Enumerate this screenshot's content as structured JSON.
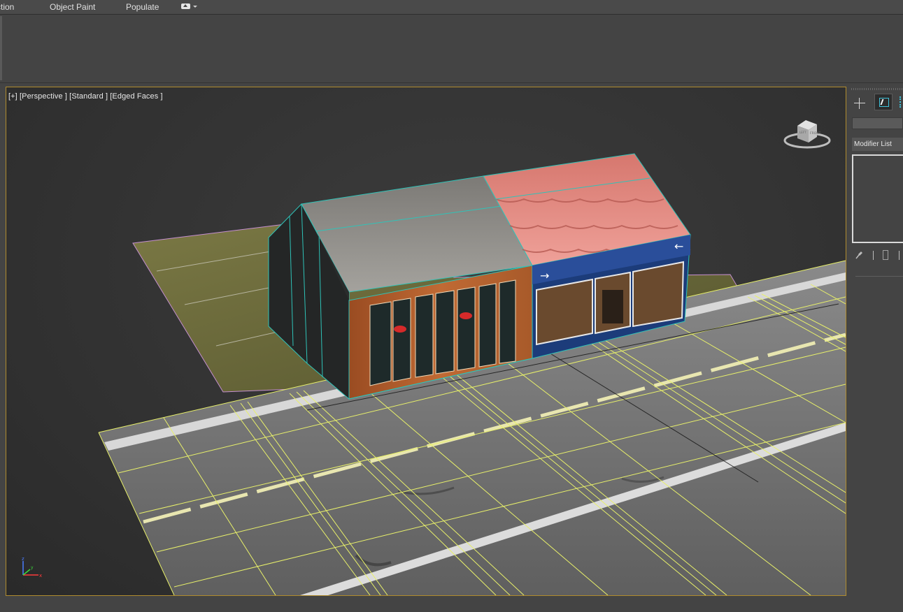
{
  "menubar": {
    "tabs": [
      "ction",
      "Object Paint",
      "Populate"
    ],
    "extra_tab_icon": "collapse-ribbon-icon"
  },
  "viewport": {
    "label": "[+] [Perspective ] [Standard ] [Edged Faces ]",
    "viewcube_face_front": "FRONT",
    "viewcube_face_left": "LEFT",
    "axis_x": "x",
    "axis_y": "y",
    "axis_z": "z",
    "scene": {
      "objects": [
        "grass-ground",
        "road-plane",
        "shop-brown-gray-roof",
        "shop-blue-red-roof"
      ],
      "colors": {
        "border_active": "#b08c2e",
        "grid_lines": "#e8f06a",
        "edge_highlight": "#2fc3b8",
        "red_roof": "#e0857d",
        "gray_roof": "#8c8a86",
        "shop_wood": "#b4602e",
        "shop_blue": "#1c3c7a",
        "grass": "#6e6c3c",
        "road": "#7a7a7a"
      }
    }
  },
  "command_panel": {
    "tabs": [
      "create-tab",
      "modify-tab",
      "hierarchy-tab"
    ],
    "name_field": "",
    "modifier_list_label": "Modifier List"
  }
}
